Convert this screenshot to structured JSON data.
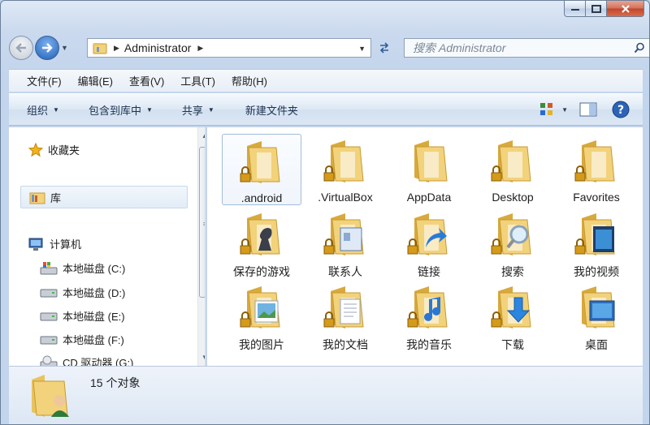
{
  "window": {
    "caption_buttons": [
      "minimize",
      "maximize",
      "close"
    ]
  },
  "address_bar": {
    "crumb": "Administrator",
    "search_placeholder": "搜索 Administrator"
  },
  "menu": [
    "文件(F)",
    "编辑(E)",
    "查看(V)",
    "工具(T)",
    "帮助(H)"
  ],
  "commands": {
    "organize": "组织",
    "include_in_library": "包含到库中",
    "share": "共享",
    "new_folder": "新建文件夹"
  },
  "nav_pane": {
    "favorites": "收藏夹",
    "libraries": "库",
    "computer": "计算机",
    "drives": [
      "本地磁盘 (C:)",
      "本地磁盘 (D:)",
      "本地磁盘 (E:)",
      "本地磁盘 (F:)",
      "CD 驱动器 (G:)"
    ]
  },
  "items": [
    {
      "label": ".android",
      "icon": "locked-folder-icon"
    },
    {
      "label": ".VirtualBox",
      "icon": "locked-folder-icon"
    },
    {
      "label": "AppData",
      "icon": "folder-icon"
    },
    {
      "label": "Desktop",
      "icon": "locked-folder-icon"
    },
    {
      "label": "Favorites",
      "icon": "locked-folder-icon"
    },
    {
      "label": "保存的游戏",
      "icon": "saved-games-folder-icon"
    },
    {
      "label": "联系人",
      "icon": "contacts-folder-icon"
    },
    {
      "label": "链接",
      "icon": "links-folder-icon"
    },
    {
      "label": "搜索",
      "icon": "searches-folder-icon"
    },
    {
      "label": "我的视频",
      "icon": "videos-folder-icon"
    },
    {
      "label": "我的图片",
      "icon": "pictures-folder-icon"
    },
    {
      "label": "我的文档",
      "icon": "documents-folder-icon"
    },
    {
      "label": "我的音乐",
      "icon": "music-folder-icon"
    },
    {
      "label": "下载",
      "icon": "downloads-folder-icon"
    },
    {
      "label": "桌面",
      "icon": "desktop-folder-icon"
    }
  ],
  "status": {
    "count": "15 个对象"
  },
  "colors": {
    "folder": "#f2d27a",
    "folder_dark": "#d8a93c",
    "accent": "#1d5fb8",
    "lock": "#d49a1a"
  }
}
